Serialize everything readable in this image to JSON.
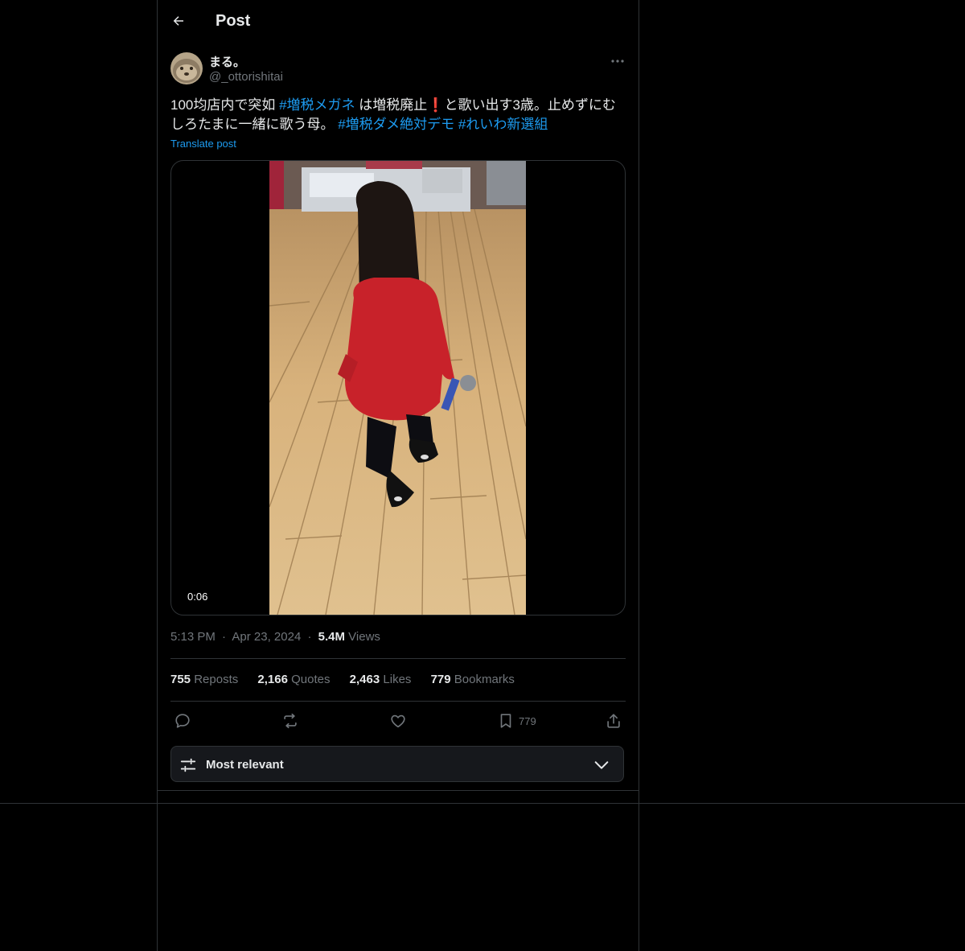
{
  "header": {
    "title": "Post"
  },
  "author": {
    "name": "まる。",
    "handle": "@_ottorishitai"
  },
  "tweet": {
    "segments": [
      {
        "text": "100均店内で突如 ",
        "hashtag": false
      },
      {
        "text": "#増税メガネ",
        "hashtag": true
      },
      {
        "text": " は増税廃止",
        "hashtag": false
      },
      {
        "text": "❗",
        "hashtag": false,
        "emoji": true
      },
      {
        "text": "と歌い出す3歳。止めずにむしろたまに一緒に歌う母。 ",
        "hashtag": false
      },
      {
        "text": "#増税ダメ絶対デモ",
        "hashtag": true
      },
      {
        "text": " ",
        "hashtag": false
      },
      {
        "text": "#れいわ新選組",
        "hashtag": true
      }
    ],
    "translate_label": "Translate post"
  },
  "media": {
    "duration": "0:06"
  },
  "meta": {
    "time": "5:13 PM",
    "date": "Apr 23, 2024",
    "views_count": "5.4M",
    "views_label": "Views",
    "separator": "·"
  },
  "stats": [
    {
      "count": "755",
      "label": "Reposts"
    },
    {
      "count": "2,166",
      "label": "Quotes"
    },
    {
      "count": "2,463",
      "label": "Likes"
    },
    {
      "count": "779",
      "label": "Bookmarks"
    }
  ],
  "actions": {
    "reply": {
      "icon": "reply-icon",
      "count": ""
    },
    "repost": {
      "icon": "repost-icon",
      "count": ""
    },
    "like": {
      "icon": "heart-icon",
      "count": ""
    },
    "bookmark": {
      "icon": "bookmark-icon",
      "count": "779"
    },
    "share": {
      "icon": "share-icon",
      "count": ""
    }
  },
  "sort": {
    "label": "Most relevant"
  },
  "colors": {
    "background": "#000000",
    "text": "#e7e9ea",
    "muted": "#71767b",
    "accent": "#1d9bf0",
    "border": "#2f3336"
  }
}
